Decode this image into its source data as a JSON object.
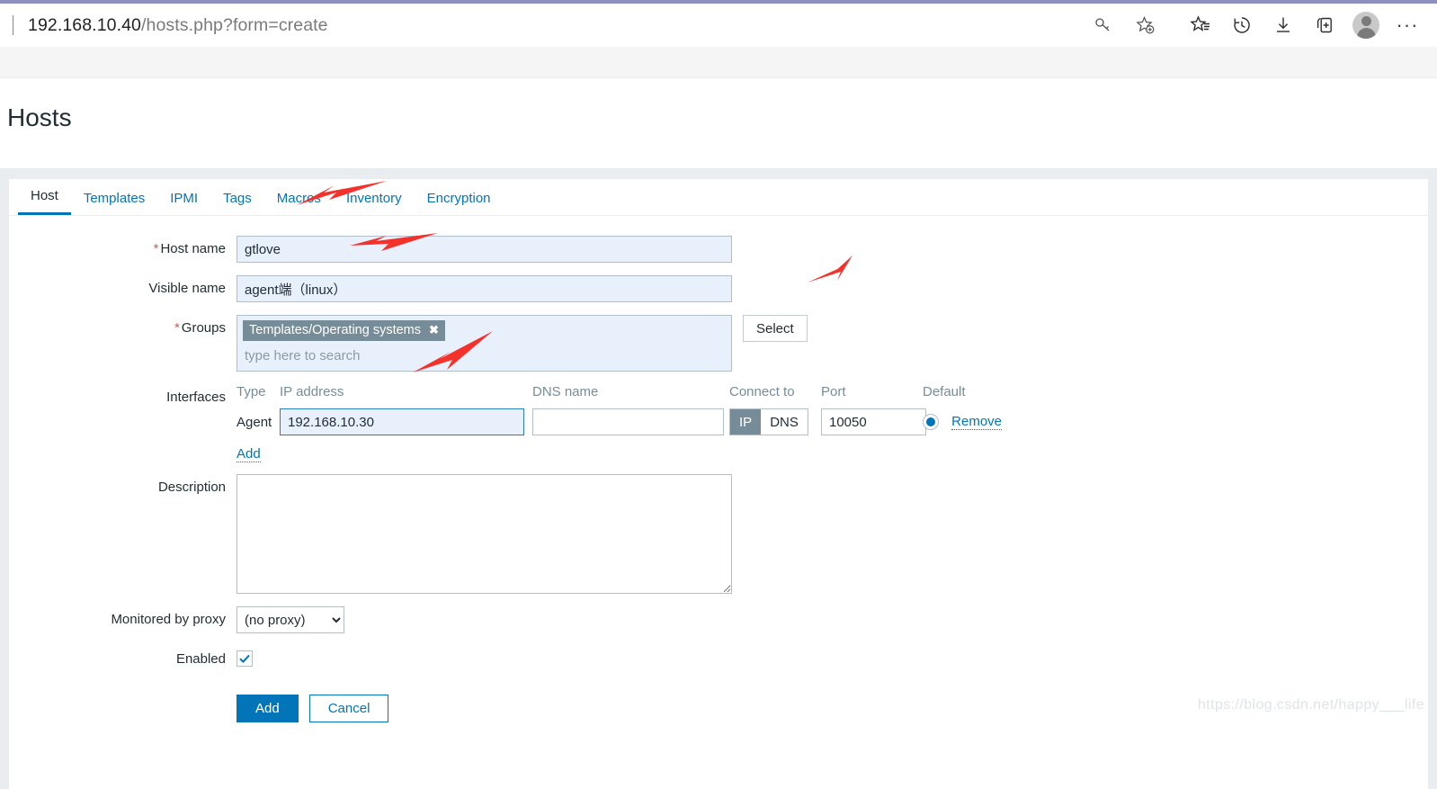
{
  "browser": {
    "url_host": "192.168.10.40",
    "url_path": "/hosts.php?form=create",
    "toolbar_icons": [
      {
        "name": "password-key-icon",
        "label": "key"
      },
      {
        "name": "add-favorite-icon",
        "label": "star-plus"
      },
      {
        "name": "favorites-icon",
        "label": "star-list"
      },
      {
        "name": "history-icon",
        "label": "history"
      },
      {
        "name": "downloads-icon",
        "label": "download"
      },
      {
        "name": "collections-icon",
        "label": "collections"
      },
      {
        "name": "profile-avatar",
        "label": "profile"
      },
      {
        "name": "settings-more-icon",
        "label": "..."
      }
    ],
    "more_glyph": "···"
  },
  "page": {
    "title": "Hosts"
  },
  "tabs": [
    {
      "label": "Host",
      "active": true
    },
    {
      "label": "Templates",
      "active": false
    },
    {
      "label": "IPMI",
      "active": false
    },
    {
      "label": "Tags",
      "active": false
    },
    {
      "label": "Macros",
      "active": false
    },
    {
      "label": "Inventory",
      "active": false
    },
    {
      "label": "Encryption",
      "active": false
    }
  ],
  "form": {
    "host_name": {
      "label": "Host name",
      "required": true,
      "value": "gtlove"
    },
    "visible_name": {
      "label": "Visible name",
      "required": false,
      "value": "agent端（linux）"
    },
    "groups": {
      "label": "Groups",
      "required": true,
      "chip": "Templates/Operating systems",
      "chip_remove": "✖",
      "placeholder": "type here to search",
      "select_button": "Select"
    },
    "interfaces": {
      "label": "Interfaces",
      "columns": [
        "Type",
        "IP address",
        "DNS name",
        "Connect to",
        "Port",
        "Default"
      ],
      "rows": [
        {
          "type": "Agent",
          "ip": "192.168.10.30",
          "dns": "",
          "connect_to": "IP",
          "connect_options": [
            "IP",
            "DNS"
          ],
          "port": "10050",
          "default_selected": true,
          "remove_label": "Remove"
        }
      ],
      "add_label": "Add"
    },
    "description": {
      "label": "Description",
      "value": ""
    },
    "proxy": {
      "label": "Monitored by proxy",
      "value": "(no proxy)",
      "options": [
        "(no proxy)"
      ]
    },
    "enabled": {
      "label": "Enabled",
      "checked": true
    },
    "buttons": {
      "submit": "Add",
      "cancel": "Cancel"
    }
  },
  "watermark": "https://blog.csdn.net/happy___life",
  "colors": {
    "accent_blue": "#0275b8",
    "chip_gray": "#768d99",
    "field_blue_bg": "#e8f0fb",
    "required_red": "#d45c4b",
    "arrow_red": "#f4322c"
  }
}
